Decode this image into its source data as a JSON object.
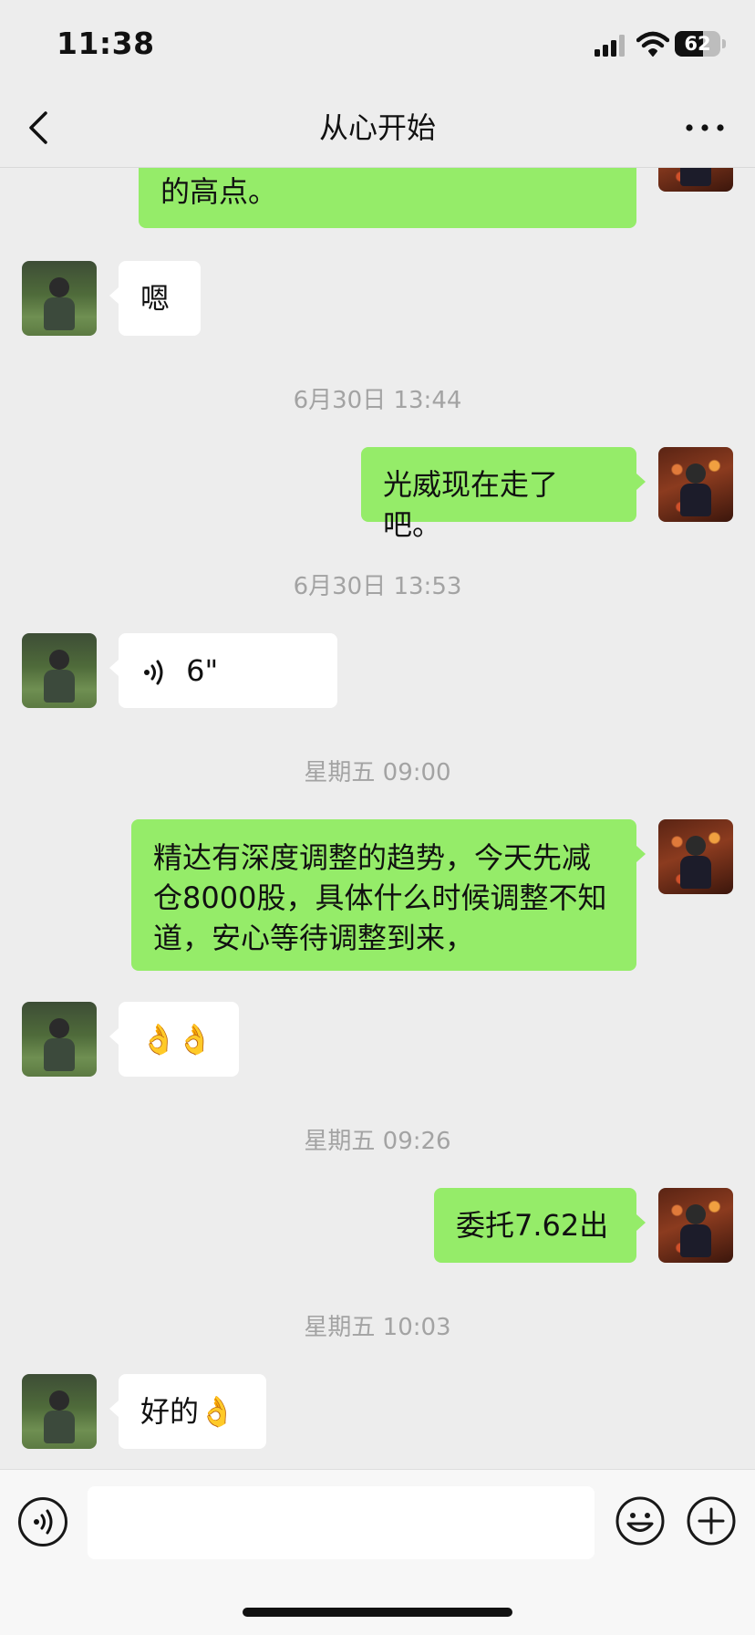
{
  "status_bar": {
    "time": "11:38",
    "battery": "62",
    "battery_level": 0.62
  },
  "nav": {
    "title": "从心开始"
  },
  "messages": [
    {
      "side": "out",
      "type": "text",
      "text": "的高点。"
    },
    {
      "side": "in",
      "type": "text",
      "text": "嗯"
    },
    {
      "type": "timestamp",
      "text": "6月30日 13:44"
    },
    {
      "side": "out",
      "type": "text",
      "text": "光威现在走了吧。"
    },
    {
      "type": "timestamp",
      "text": "6月30日 13:53"
    },
    {
      "side": "in",
      "type": "voice",
      "text": "6\""
    },
    {
      "type": "timestamp",
      "text": "星期五 09:00"
    },
    {
      "side": "out",
      "type": "text",
      "text": "精达有深度调整的趋势，今天先减仓8000股，具体什么时候调整不知道，安心等待调整到来，"
    },
    {
      "side": "in",
      "type": "text",
      "text": "👌👌"
    },
    {
      "type": "timestamp",
      "text": "星期五 09:26"
    },
    {
      "side": "out",
      "type": "text",
      "text": "委托7.62出"
    },
    {
      "type": "timestamp",
      "text": "星期五 10:03"
    },
    {
      "side": "in",
      "type": "text",
      "text": "好的👌"
    }
  ],
  "input": {
    "value": ""
  },
  "colors": {
    "out_bubble": "#95ec69",
    "in_bubble": "#ffffff",
    "background": "#ededed",
    "timestamp": "#a3a3a3"
  },
  "icons": [
    "back-icon",
    "more-icon",
    "voice-icon",
    "emoji-icon",
    "plus-icon",
    "signal-icon",
    "wifi-icon",
    "battery-icon"
  ]
}
